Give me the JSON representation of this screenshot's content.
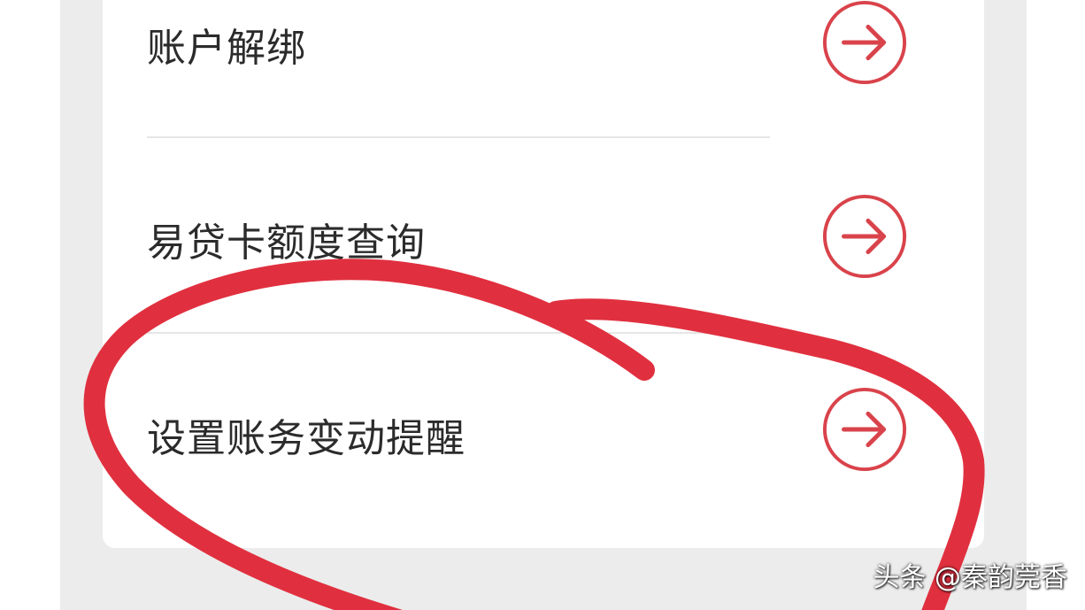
{
  "menu": {
    "items": [
      {
        "label": "账户解绑",
        "icon": "arrow-right-circle-icon"
      },
      {
        "label": "易贷卡额度查询",
        "icon": "arrow-right-circle-icon"
      },
      {
        "label": "设置账务变动提醒",
        "icon": "arrow-right-circle-icon"
      }
    ]
  },
  "colors": {
    "accent": "#d9434b",
    "annotation": "#e0303f",
    "background": "#ececec",
    "card": "#ffffff",
    "text": "#2b2b2b"
  },
  "watermark": {
    "text": "头条 @秦韵莞香"
  }
}
